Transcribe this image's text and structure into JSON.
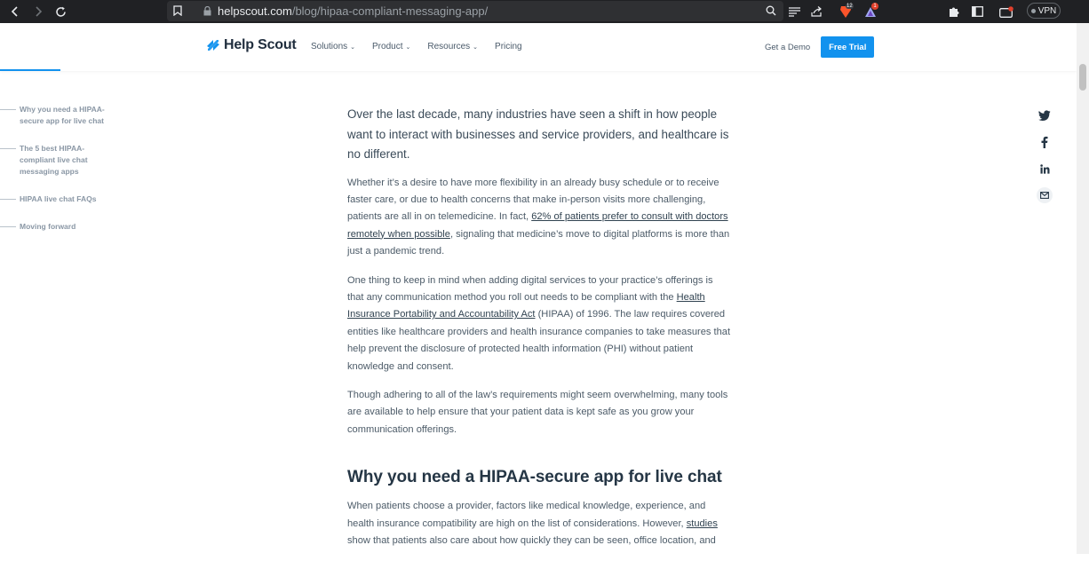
{
  "browser": {
    "url_host": "helpscout.com",
    "url_path": "/blog/hipaa-compliant-messaging-app/",
    "brave_badge": "12",
    "rewards_badge": "1",
    "vpn_label": "VPN",
    "icons": [
      "back-icon",
      "forward-icon",
      "reload-icon",
      "bookmark-icon",
      "lock-icon",
      "search-icon",
      "reader-icon",
      "share-icon",
      "brave-shield-icon",
      "brave-rewards-icon",
      "extensions-icon",
      "sidebar-icon",
      "wallet-icon"
    ]
  },
  "header": {
    "logo_text": "Help Scout",
    "nav": [
      "Solutions",
      "Product",
      "Resources",
      "Pricing"
    ],
    "demo_label": "Get a Demo",
    "trial_label": "Free Trial",
    "brand_color": "#1292ee"
  },
  "toc": {
    "items": [
      "Why you need a HIPAA-secure app for live chat",
      "The 5 best HIPAA-compliant live chat messaging apps",
      "HIPAA live chat FAQs",
      "Moving forward"
    ]
  },
  "article": {
    "lead": "Over the last decade, many industries have seen a shift in how people want to interact with businesses and service providers, and healthcare is no different.",
    "p1_a": "Whether it’s a desire to have more flexibility in an already busy schedule or to receive faster care, or due to health concerns that make in-person visits more challenging, patients are all in on telemedicine. In fact, ",
    "p1_link": "62% of patients prefer to consult with doctors remotely when possible",
    "p1_b": ", signaling that medicine’s move to digital platforms is more than just a pandemic trend.",
    "p2_a": "One thing to keep in mind when adding digital services to your practice’s offerings is that any communication method you roll out needs to be compliant with the ",
    "p2_link": "Health Insurance Portability and Accountability Act",
    "p2_b": " (HIPAA) of 1996. The law requires covered entities like healthcare providers and health insurance companies to take measures that help prevent the disclosure of protected health information (PHI) without patient knowledge and consent.",
    "p3": "Though adhering to all of the law’s requirements might seem overwhelming, many tools are available to help ensure that your patient data is kept safe as you grow your communication offerings.",
    "h2": "Why you need a HIPAA-secure app for live chat",
    "p4_a": "When patients choose a provider, factors like medical knowledge, experience, and health insurance compatibility are high on the list of considerations. However, ",
    "p4_link": "studies",
    "p4_b": " show that patients also care about how quickly they can be seen, office location, and"
  },
  "share": {
    "icons": [
      "twitter-icon",
      "facebook-icon",
      "linkedin-icon",
      "email-icon"
    ]
  }
}
